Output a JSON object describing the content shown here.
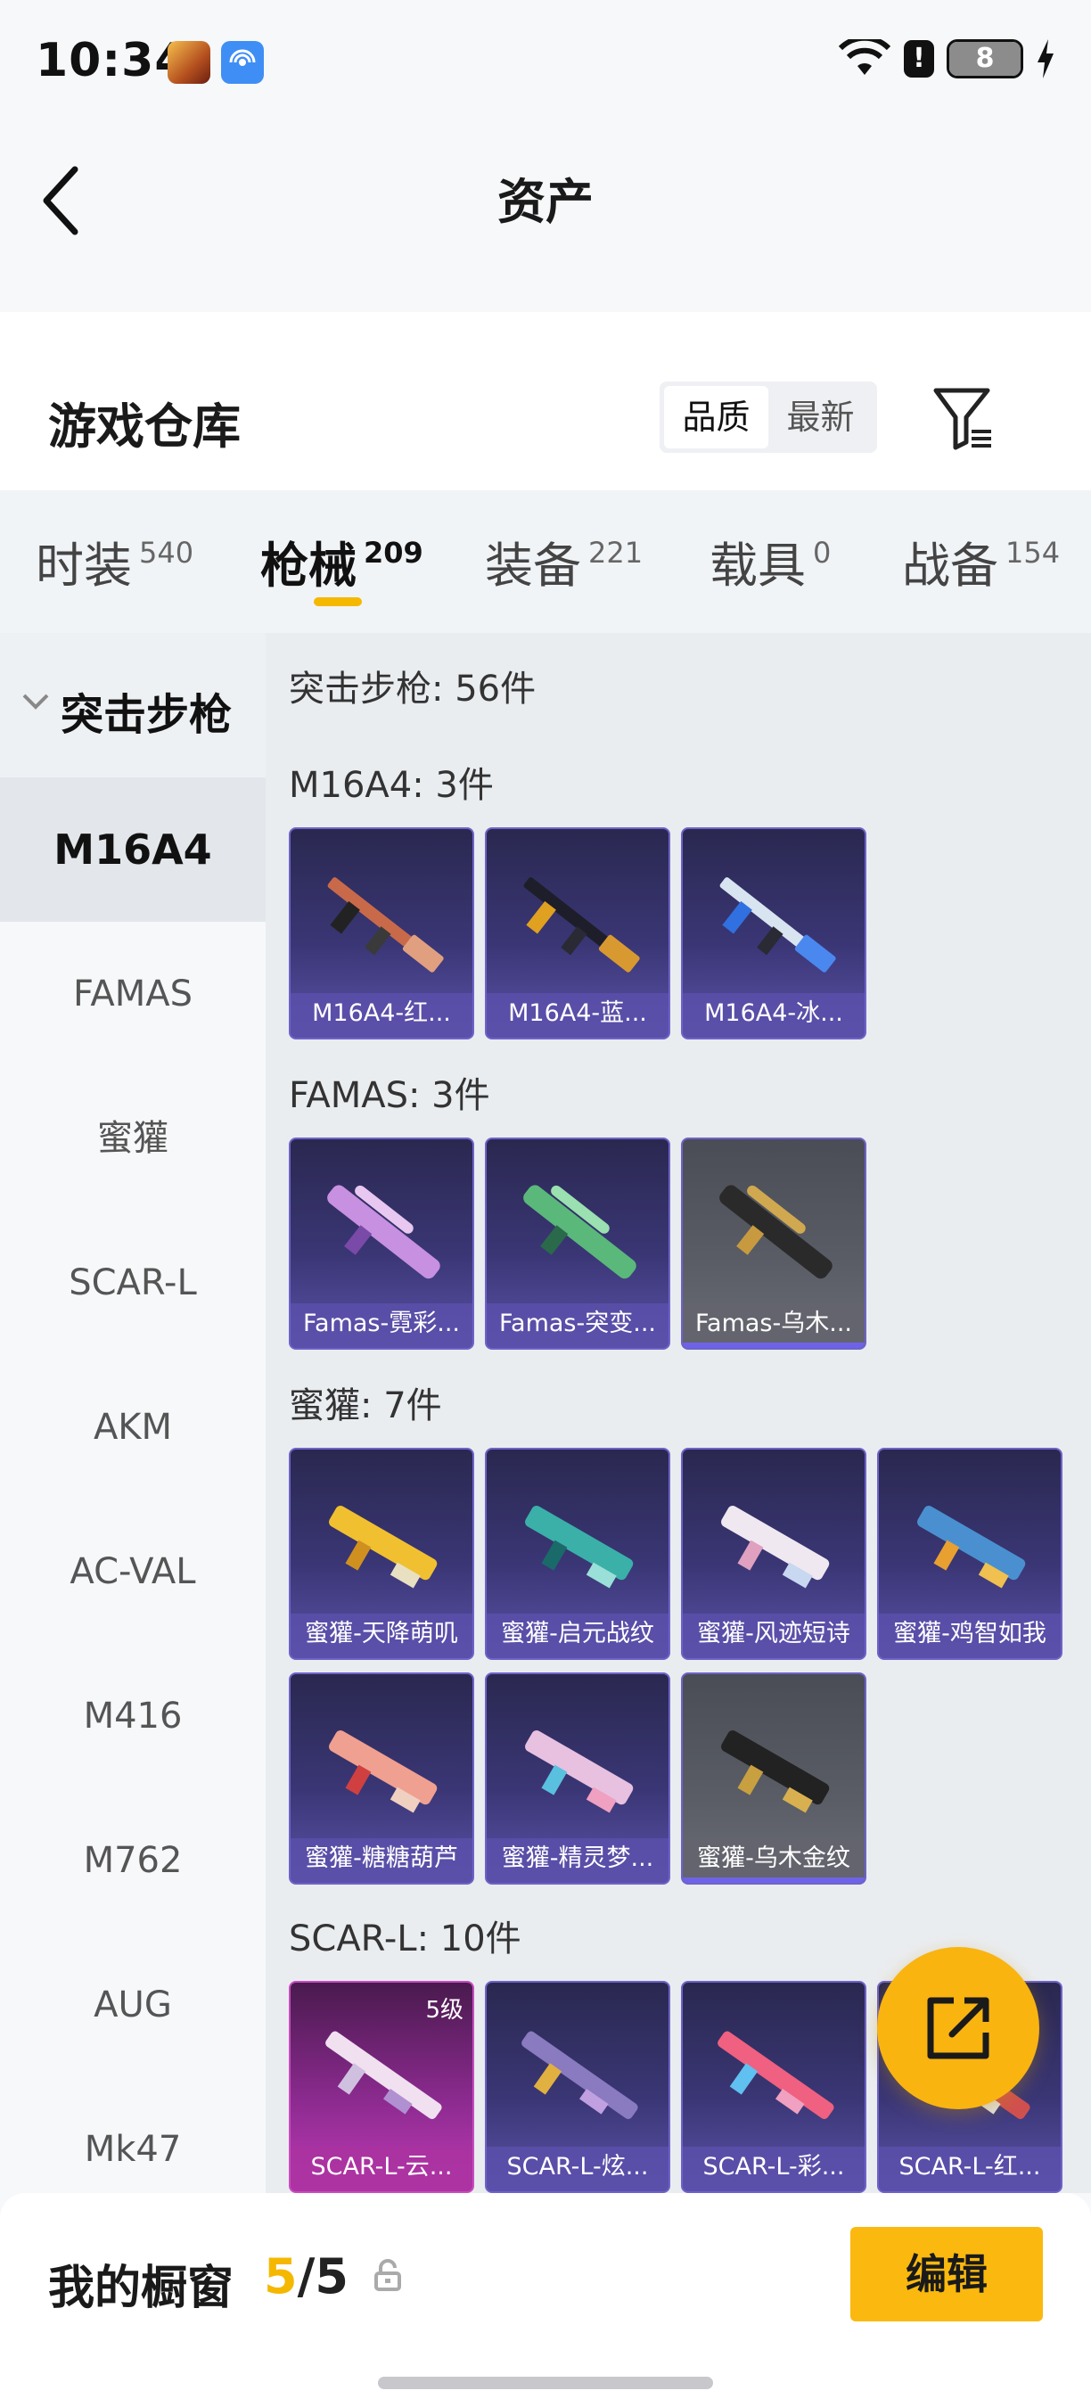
{
  "status_bar": {
    "time": "10:34",
    "battery": "8",
    "alert": "!"
  },
  "nav": {
    "title": "资产",
    "back_icon": "back-arrow-icon"
  },
  "warehouse": {
    "title": "游戏仓库",
    "sort_options": [
      "品质",
      "最新"
    ],
    "active_sort": "品质",
    "filter_icon": "filter-icon"
  },
  "tabs": [
    {
      "label": "时装",
      "count": "540"
    },
    {
      "label": "枪械",
      "count": "209"
    },
    {
      "label": "装备",
      "count": "221"
    },
    {
      "label": "载具",
      "count": "0"
    },
    {
      "label": "战备",
      "count": "154"
    }
  ],
  "active_tab": "枪械",
  "sidebar": {
    "group": "突击步枪",
    "items": [
      "M16A4",
      "FAMAS",
      "蜜獾",
      "SCAR-L",
      "AKM",
      "AC-VAL",
      "M416",
      "M762",
      "AUG",
      "Mk47"
    ],
    "active": "M16A4"
  },
  "content": {
    "group_heading": "突击步枪: 56件",
    "sections": [
      {
        "heading": "M16A4: 3件",
        "items": [
          "M16A4-红...",
          "M16A4-蓝...",
          "M16A4-冰..."
        ]
      },
      {
        "heading": "FAMAS: 3件",
        "items": [
          "Famas-霓彩...",
          "Famas-突变...",
          "Famas-乌木..."
        ]
      },
      {
        "heading": "蜜獾: 7件",
        "items": [
          "蜜獾-天降萌叽",
          "蜜獾-启元战纹",
          "蜜獾-风迹短诗",
          "蜜獾-鸡智如我",
          "蜜獾-糖糖葫芦",
          "蜜獾-精灵梦...",
          "蜜獾-乌木金纹"
        ]
      },
      {
        "heading": "SCAR-L: 10件",
        "items": [
          "SCAR-L-云...",
          "SCAR-L-炫...",
          "SCAR-L-彩...",
          "SCAR-L-红..."
        ],
        "level_badge": "5级"
      }
    ]
  },
  "bottom_bar": {
    "label": "我的橱窗",
    "count_current": "5",
    "count_sep": "/",
    "count_total": "5",
    "edit_label": "编辑"
  },
  "colors": {
    "accent": "#f5b800",
    "card_purple": "#3a3675",
    "card_grey": "#5a5d66",
    "card_pink": "#8a2a8e"
  }
}
